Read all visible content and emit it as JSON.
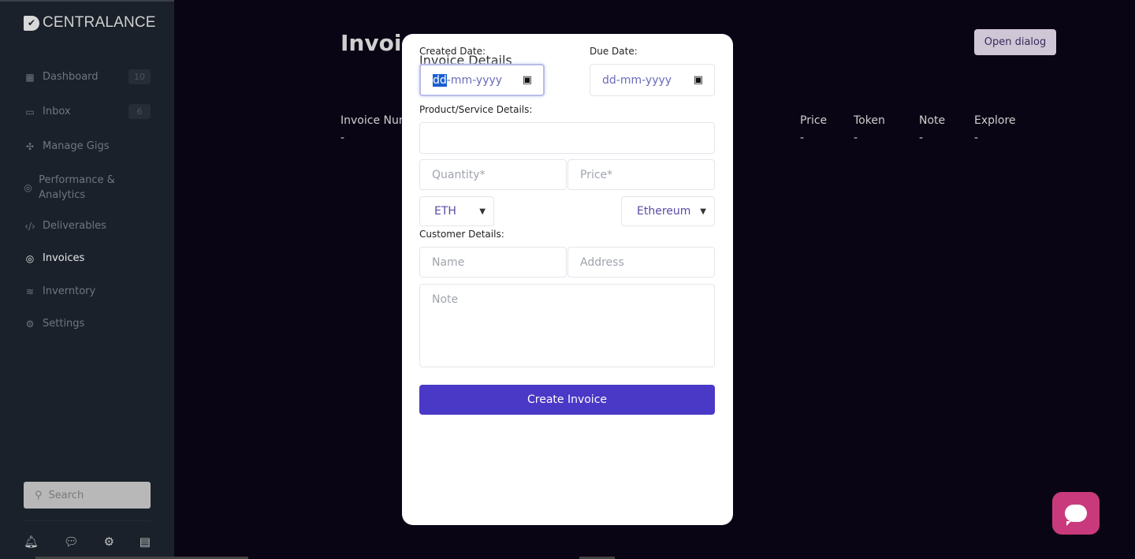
{
  "brand": {
    "name": "CENTRALANCE"
  },
  "sidebar": {
    "items": [
      {
        "label": "Dashboard",
        "icon": "grid-icon",
        "badge": "10"
      },
      {
        "label": "Inbox",
        "icon": "inbox-icon",
        "badge": "6"
      },
      {
        "label": "Manage Gigs",
        "icon": "puzzle-icon"
      },
      {
        "label": "Performance & Analytics",
        "icon": "compass-icon"
      },
      {
        "label": "Deliverables",
        "icon": "code-icon"
      },
      {
        "label": "Invoices",
        "icon": "compass-icon",
        "active": true
      },
      {
        "label": "Inverntory",
        "icon": "layers-icon"
      },
      {
        "label": "Settings",
        "icon": "gear-icon"
      }
    ],
    "search_placeholder": "Search"
  },
  "main": {
    "title": "Invoic",
    "open_dialog": "Open dialog",
    "columns": [
      "Invoice Num",
      "Price",
      "Token",
      "Note",
      "Explore"
    ],
    "row": [
      "-",
      "-",
      "-",
      "-",
      "-"
    ]
  },
  "modal": {
    "heading": "Invoice Details",
    "created_label": "Created Date:",
    "due_label": "Due Date:",
    "date_dd": "dd",
    "date_rest": "-mm-yyyy",
    "date_placeholder": "dd-mm-yyyy",
    "product_label": "Product/Service Details:",
    "quantity_placeholder": "Quantity*",
    "price_placeholder": "Price*",
    "token": "ETH",
    "network": "Ethereum",
    "customer_label": "Customer Details:",
    "name_placeholder": "Name",
    "address_placeholder": "Address",
    "note_placeholder": "Note",
    "create_button": "Create Invoice"
  },
  "colors": {
    "accent": "#4a38c7",
    "chat": "#c93a7c",
    "sidebar": "#1a212b",
    "background": "#0a0514"
  }
}
